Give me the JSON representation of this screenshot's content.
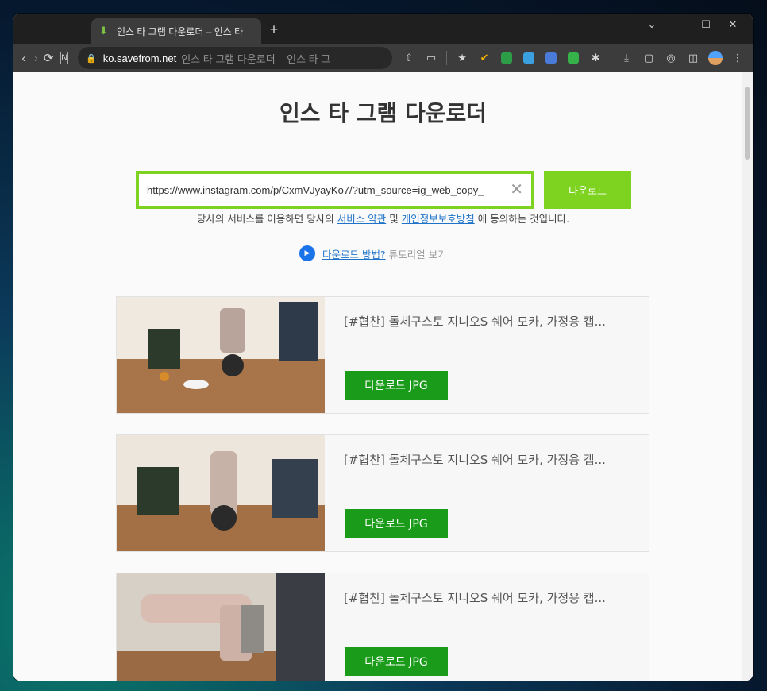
{
  "browser": {
    "tab_title": "인스 타 그램 다운로더 – 인스 타",
    "url_host": "ko.savefrom.net",
    "url_rest": "인스 타 그램 다운로더 – 인스 타 그"
  },
  "page": {
    "title": "인스 타 그램 다운로더",
    "search": {
      "value": "https://www.instagram.com/p/CxmVJyayKo7/?utm_source=ig_web_copy_",
      "button_label": "다운로드"
    },
    "terms": {
      "prefix": "당사의 서비스를 이용하면 당사의",
      "link1": "서비스 약관",
      "middle": "및",
      "link2": "개인정보보호방침",
      "suffix": "에 동의하는 것입니다."
    },
    "howto": {
      "link": "다운로드 방법?",
      "sub": "튜토리얼 보기"
    },
    "results": [
      {
        "title": "[#협찬] 돌체구스토 지니오S 쉐어 모카, 가정용 캡...",
        "button": "다운로드  JPG"
      },
      {
        "title": "[#협찬] 돌체구스토 지니오S 쉐어 모카, 가정용 캡...",
        "button": "다운로드  JPG"
      },
      {
        "title": "[#협찬] 돌체구스토 지니오S 쉐어 모카, 가정용 캡...",
        "button": "다운로드  JPG"
      }
    ]
  },
  "colors": {
    "accent_green": "#7ed321",
    "button_green": "#1a9b1a",
    "link_blue": "#1e73c8"
  }
}
